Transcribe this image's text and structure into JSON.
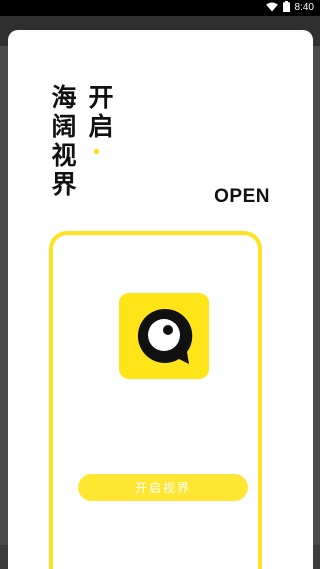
{
  "status_bar": {
    "time": "8:40",
    "wifi_icon": "wifi-icon",
    "battery_icon": "battery-icon"
  },
  "sheet": {
    "headline_left": "海阔视界",
    "headline_right": "开启",
    "open_label": "OPEN",
    "logo_icon": "app-logo-icon",
    "button_label": "开启视界"
  },
  "colors": {
    "accent": "#ffe419",
    "text": "#111111",
    "background": "#ffffff"
  }
}
